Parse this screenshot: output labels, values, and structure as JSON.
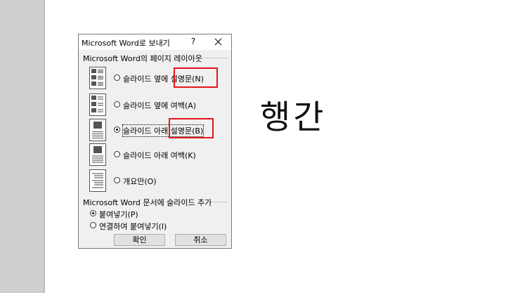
{
  "slide": {
    "text": "행간"
  },
  "dialog": {
    "title": "Microsoft Word로 보내기",
    "help": "?",
    "layout_group": {
      "title": "Microsoft Word의 페이지 레이아웃",
      "options": [
        {
          "label": "슬라이드 옆에 설명문(N)",
          "checked": false
        },
        {
          "label": "슬라이드 옆에 여백(A)",
          "checked": false
        },
        {
          "label": "슬라이드 아래 설명문(B)",
          "checked": true
        },
        {
          "label": "슬라이드 아래 여백(K)",
          "checked": false
        },
        {
          "label": "개요만(O)",
          "checked": false
        }
      ]
    },
    "add_group": {
      "title": "Microsoft Word 문서에 슬라이드 추가",
      "options": [
        {
          "label": "붙여넣기(P)",
          "checked": true
        },
        {
          "label": "연결하여 붙여넣기(I)",
          "checked": false
        }
      ]
    },
    "ok": "확인",
    "cancel": "취소"
  },
  "colors": {
    "highlight": "#e8141c",
    "app_gray": "#cfcfcf"
  }
}
